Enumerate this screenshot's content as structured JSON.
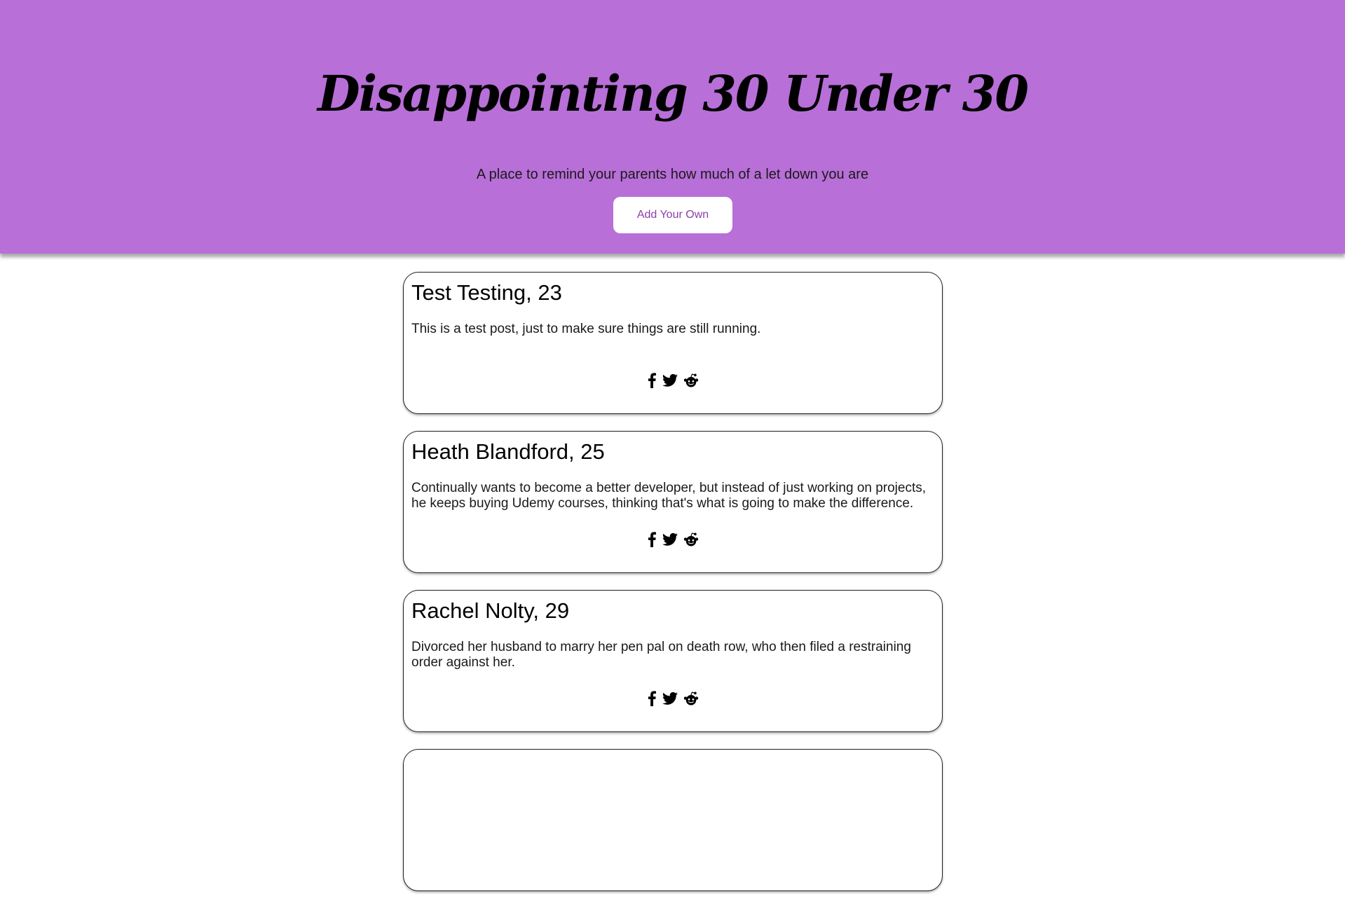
{
  "header": {
    "title": "Disappointing 30 Under 30",
    "subtitle": "A place to remind your parents how much of a let down you are",
    "add_button_label": "Add Your Own"
  },
  "colors": {
    "hero_background": "#b86fd8",
    "button_text": "#8a3fab"
  },
  "share_icons": [
    "facebook-icon",
    "twitter-icon",
    "reddit-icon"
  ],
  "posts": [
    {
      "title": "Test Testing, 23",
      "body": "This is a test post, just to make sure things are still running."
    },
    {
      "title": "Heath Blandford, 25",
      "body": "Continually wants to become a better developer, but instead of just working on projects, he keeps buying Udemy courses, thinking that's what is going to make the difference."
    },
    {
      "title": "Rachel Nolty, 29",
      "body": "Divorced her husband to marry her pen pal on death row, who then filed a restraining order against her."
    }
  ]
}
